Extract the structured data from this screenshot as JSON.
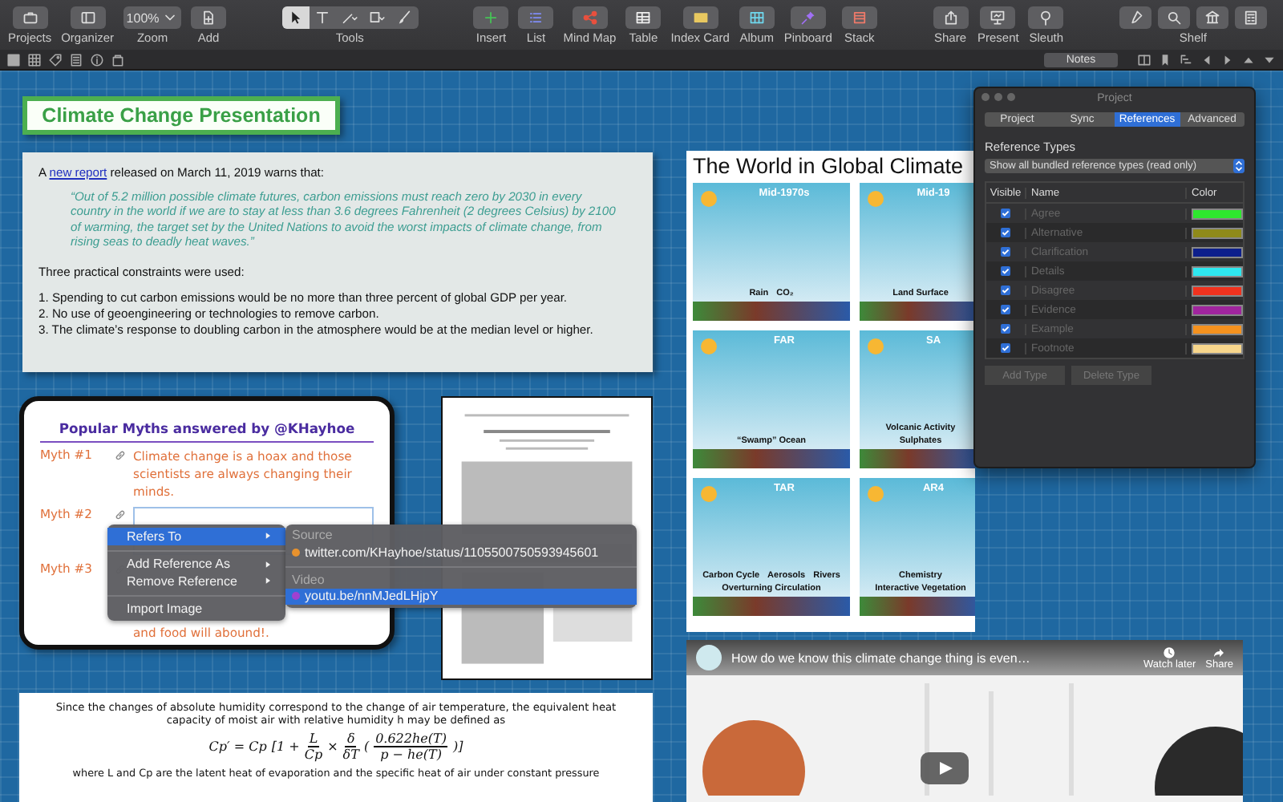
{
  "toolbar": {
    "left": [
      {
        "kind": "button",
        "label": "Projects"
      },
      {
        "kind": "button",
        "label": "Organizer"
      },
      {
        "kind": "zoom",
        "value": "100%",
        "label": "Zoom"
      },
      {
        "kind": "button",
        "label": "Add"
      }
    ],
    "tools": {
      "label": "Tools",
      "items": [
        {
          "selected": true
        },
        {
          "selected": false
        },
        {
          "selected": false
        },
        {
          "selected": false
        },
        {
          "selected": false
        }
      ]
    },
    "views": [
      {
        "label": "Insert"
      },
      {
        "label": "List"
      },
      {
        "label": "Mind Map"
      },
      {
        "label": "Table"
      },
      {
        "label": "Index Card"
      },
      {
        "label": "Album"
      },
      {
        "label": "Pinboard"
      },
      {
        "label": "Stack"
      }
    ],
    "actions": [
      {
        "label": "Share"
      },
      {
        "label": "Present"
      },
      {
        "label": "Sleuth"
      }
    ],
    "shelf": {
      "label": "Shelf"
    }
  },
  "secondary_bar": {
    "notes_button": "Notes"
  },
  "title_card": "Climate Change Presentation",
  "report_note": {
    "intro_before": "A ",
    "link": "new report",
    "intro_after": " released on March 11, 2019 warns that:",
    "quote": "“Out of 5.2 million possible climate futures, carbon emissions must reach zero by 2030 in every country in the world if we are to stay at less than 3.6 degrees Fahrenheit (2 degrees Celsius) by 2100 of warming, the target set by the United Nations to avoid the worst impacts of climate change, from rising seas to deadly heat waves.”",
    "lead": "Three practical constraints were used:",
    "items": [
      "1. Spending to cut carbon emissions would be no more than three percent of global GDP per year.",
      "2. No use of geoengineering or technologies to remove carbon.",
      "3. The climate’s response to doubling carbon in the atmosphere would be at the median level or higher."
    ]
  },
  "myths_card": {
    "title": "Popular Myths answered by @KHayhoe",
    "myths": [
      {
        "label": "Myth #1",
        "kind": "text",
        "text": "Climate change is a hoax and those scientists are always changing their minds."
      },
      {
        "label": "Myth #2",
        "kind": "editing"
      },
      {
        "label": "Myth #3",
        "kind": "covered",
        "text": "and food will abound!."
      }
    ]
  },
  "figure": {
    "title": "The World in Global Climate",
    "panels": [
      {
        "title": "Mid-1970s",
        "labels": [
          "Rain",
          "CO₂"
        ]
      },
      {
        "title": "Mid-19",
        "labels": [
          "Land Surface"
        ]
      },
      {
        "title": "FAR",
        "labels": [
          "“Swamp” Ocean"
        ]
      },
      {
        "title": "SA",
        "labels": [
          "Volcanic Activity",
          "Sulphates"
        ]
      },
      {
        "title": "TAR",
        "labels": [
          "Carbon Cycle",
          "Aerosols",
          "Rivers",
          "Overturning Circulation"
        ]
      },
      {
        "title": "AR4",
        "labels": [
          "Chemistry",
          "Interactive Vegetation"
        ]
      }
    ]
  },
  "formula_card": {
    "text": "Since the changes of absolute humidity correspond to the change of air temperature, the equivalent heat capacity of moist air with relative humidity h may be defined as",
    "formula": [
      {
        "kind": "text",
        "text": "Cp′ = Cp"
      },
      {
        "kind": "text",
        "text": "[1 +"
      },
      {
        "kind": "frac",
        "num": "L",
        "den": "Cp"
      },
      {
        "kind": "text",
        "text": "×"
      },
      {
        "kind": "frac",
        "num": "δ",
        "den": "δT"
      },
      {
        "kind": "text",
        "text": "("
      },
      {
        "kind": "frac",
        "num": "0.622he(T)",
        "den": "p − he(T)"
      },
      {
        "kind": "text",
        "text": ")]"
      }
    ],
    "tail": "where L and Cp are the latent heat of evaporation and the specific heat of air under constant pressure"
  },
  "video": {
    "title": "How do we know this climate change thing is even…",
    "actions": [
      {
        "label": "Watch later"
      },
      {
        "label": "Share"
      }
    ]
  },
  "project_panel": {
    "title": "Project",
    "tabs": [
      {
        "label": "Project",
        "selected": false
      },
      {
        "label": "Sync",
        "selected": false
      },
      {
        "label": "References",
        "selected": true
      },
      {
        "label": "Advanced",
        "selected": false
      }
    ],
    "section_title": "Reference Types",
    "dropdown": "Show all bundled reference types (read only)",
    "columns": [
      "Visible",
      "Name",
      "Color"
    ],
    "rows": [
      {
        "name": "Agree",
        "checked": true,
        "color": "#2ee82e"
      },
      {
        "name": "Alternative",
        "checked": true,
        "color": "#8f8a1a"
      },
      {
        "name": "Clarification",
        "checked": true,
        "color": "#0d1f8c"
      },
      {
        "name": "Details",
        "checked": true,
        "color": "#2ee8f0"
      },
      {
        "name": "Disagree",
        "checked": true,
        "color": "#f0321e"
      },
      {
        "name": "Evidence",
        "checked": true,
        "color": "#a0259e"
      },
      {
        "name": "Example",
        "checked": true,
        "color": "#f5921e"
      },
      {
        "name": "Footnote",
        "checked": true,
        "color": "#f7d68c"
      }
    ],
    "buttons": [
      {
        "label": "Add Type",
        "disabled": true
      },
      {
        "label": "Delete Type",
        "disabled": true
      }
    ]
  },
  "context_menu": {
    "groups": [
      [
        {
          "label": "Refers To",
          "submenu": true,
          "selected": true
        }
      ],
      [
        {
          "label": "Add Reference As",
          "submenu": true,
          "selected": false
        },
        {
          "label": "Remove Reference",
          "submenu": true,
          "selected": false
        }
      ],
      [
        {
          "label": "Import Image",
          "submenu": false,
          "selected": false
        }
      ]
    ],
    "submenu": [
      {
        "heading": "Source",
        "items": [
          {
            "label": "twitter.com/KHayhoe/status/1105500750593945601",
            "color": "#e8922e",
            "selected": false
          }
        ]
      },
      {
        "heading": "Video",
        "items": [
          {
            "label": "youtu.be/nnMJedLHjpY",
            "color": "#a040d0",
            "selected": true
          }
        ]
      }
    ]
  }
}
